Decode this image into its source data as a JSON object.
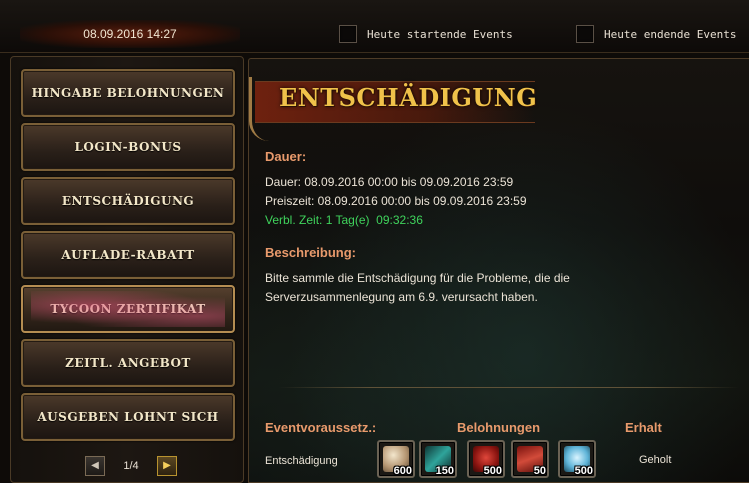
{
  "header": {
    "datetime": "08.09.2016 14:27",
    "filters": [
      {
        "label": "Heute startende Events",
        "checked": false
      },
      {
        "label": "Heute endende Events",
        "checked": false
      }
    ]
  },
  "sidebar": {
    "items": [
      {
        "label": "Hingabe Belohnungen"
      },
      {
        "label": "Login-Bonus"
      },
      {
        "label": "Entschädigung"
      },
      {
        "label": "Auflade-Rabatt"
      },
      {
        "label": "Tycoon Zertifikat",
        "active": true
      },
      {
        "label": "Zeitl. Angebot"
      },
      {
        "label": "Ausgeben lohnt sich"
      }
    ],
    "pager": {
      "text": "1/4",
      "prev_icon": "arrow-left-icon",
      "next_icon": "arrow-right-icon"
    }
  },
  "main": {
    "title": "Entschädigung",
    "duration_heading": "Dauer:",
    "duration_text": "Dauer: 08.09.2016 00:00 bis 09.09.2016 23:59",
    "prize_time_text": "Preiszeit: 08.09.2016 00:00 bis 09.09.2016 23:59",
    "remaining_text": "Verbl. Zeit: 1 Tag(e)  09:32:36",
    "description_heading": "Beschreibung:",
    "description_line1": "Bitte sammle die Entschädigung für die Probleme, die die",
    "description_line2": "Serverzusammenlegung am 6.9. verursacht haben.",
    "columns": {
      "requirement": "Eventvoraussetz.:",
      "rewards": "Belohnungen",
      "status": "Erhalt"
    },
    "row": {
      "requirement": "Entschädigung",
      "rewards": [
        {
          "icon": "orb-icon",
          "qty": "600",
          "color": "#c9b08a"
        },
        {
          "icon": "crystal-icon",
          "qty": "150",
          "color": "#3aa7a0"
        },
        {
          "icon": "red-gem-icon",
          "qty": "500",
          "color": "#b4201c"
        },
        {
          "icon": "scroll-icon",
          "qty": "50",
          "color": "#c23226"
        },
        {
          "icon": "diamond-icon",
          "qty": "500",
          "color": "#5fb4d8"
        }
      ],
      "status": "Geholt"
    }
  },
  "colors": {
    "accent_orange": "#e89a6c",
    "title_gold": "#f0c24a",
    "remaining_green": "#3fd35c"
  }
}
